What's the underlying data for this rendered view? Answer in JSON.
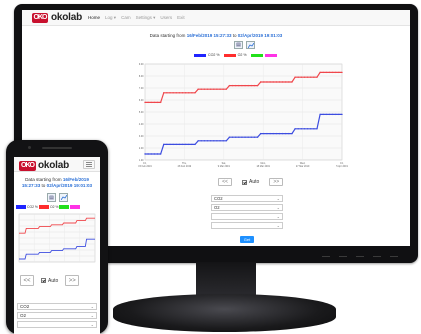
{
  "brand": {
    "name": "okolab",
    "mark": "OKO"
  },
  "nav": {
    "items": [
      {
        "label": "Home",
        "active": true
      },
      {
        "label": "Log ▾",
        "active": false
      },
      {
        "label": "Cam",
        "active": false
      },
      {
        "label": "Settings ▾",
        "active": false
      },
      {
        "label": "Users",
        "active": false
      },
      {
        "label": "Exit",
        "active": false
      }
    ]
  },
  "period": {
    "prefix": "Data starting from",
    "start": "16/Feb/2019 15:27:33",
    "mid": "to",
    "end": "02/Apr/2019 19:01:03"
  },
  "toolbar_icons": [
    "table-view-icon",
    "chart-view-icon"
  ],
  "legend": {
    "series": [
      {
        "name": "CO2 %",
        "color": "#1f24ff"
      },
      {
        "name": "O2 %",
        "color": "#ff2d2d"
      },
      {
        "name": "",
        "color": "#22e01a"
      },
      {
        "name": "",
        "color": "#ff33e6"
      }
    ]
  },
  "controls": {
    "prev": "<<",
    "next": ">>",
    "auto_label": "Auto",
    "auto_checked": true,
    "selects": [
      "CO2",
      "O2",
      "",
      ""
    ],
    "plot_button": "Get"
  },
  "colors": {
    "accent": "#1e90ff",
    "brand_red": "#c8102e",
    "series_blue": "#3d4de0",
    "series_red": "#f0474c"
  },
  "chart_data": {
    "type": "line",
    "series": [
      {
        "name": "O2 %",
        "color": "#f0474c",
        "y": [
          5.8,
          5.8,
          5.8,
          5.8,
          5.8,
          5.8,
          6.6,
          6.6,
          6.6,
          6.6,
          6.6,
          6.6,
          6.6,
          6.6,
          6.6,
          6.6,
          6.6,
          6.9,
          6.9,
          6.9,
          6.9,
          6.9,
          6.9,
          6.9,
          6.9,
          6.9,
          6.9,
          7.2,
          7.2,
          7.2,
          7.2,
          7.2,
          7.2,
          7.2,
          7.2,
          7.2,
          7.2,
          7.5,
          7.5,
          7.5,
          7.5,
          7.5,
          7.5,
          7.5,
          7.5,
          7.5,
          7.5,
          7.5,
          7.9,
          7.9,
          7.9,
          7.9,
          7.9,
          7.9,
          7.9,
          7.9,
          8.3,
          8.3,
          8.3,
          8.3,
          8.3,
          8.3,
          8.3,
          8.3
        ]
      },
      {
        "name": "CO2 %",
        "color": "#3d4de0",
        "y": [
          1.5,
          1.5,
          1.5,
          1.5,
          1.5,
          1.5,
          2.3,
          2.3,
          2.3,
          2.3,
          2.3,
          2.3,
          2.3,
          2.3,
          2.3,
          2.3,
          2.3,
          2.6,
          2.6,
          2.6,
          2.6,
          2.6,
          2.6,
          2.6,
          2.6,
          2.6,
          2.6,
          2.9,
          2.9,
          2.9,
          2.9,
          2.9,
          2.9,
          2.9,
          2.9,
          2.9,
          2.9,
          3.2,
          3.2,
          3.2,
          3.2,
          3.2,
          3.2,
          3.2,
          3.2,
          3.2,
          3.2,
          3.2,
          3.6,
          3.6,
          3.6,
          3.6,
          3.6,
          3.6,
          3.6,
          3.6,
          4.8,
          4.8,
          4.8,
          4.8,
          4.8,
          4.8,
          4.8,
          4.8
        ]
      }
    ],
    "ylim": [
      1,
      9
    ],
    "yticks": [
      "9.00",
      "8.00",
      "7.00",
      "6.00",
      "5.00",
      "4.00",
      "3.00",
      "2.00",
      "1.00"
    ],
    "xticks": [
      "Fri, 15 Feb 2019",
      "Thu, 28 Feb 2019",
      "Sat, 9 Mar 2019",
      "Mon, 18 Mar 2019",
      "Wed, 27 Mar 2019",
      "Fri, 5 Apr 2019"
    ],
    "grid": true
  }
}
